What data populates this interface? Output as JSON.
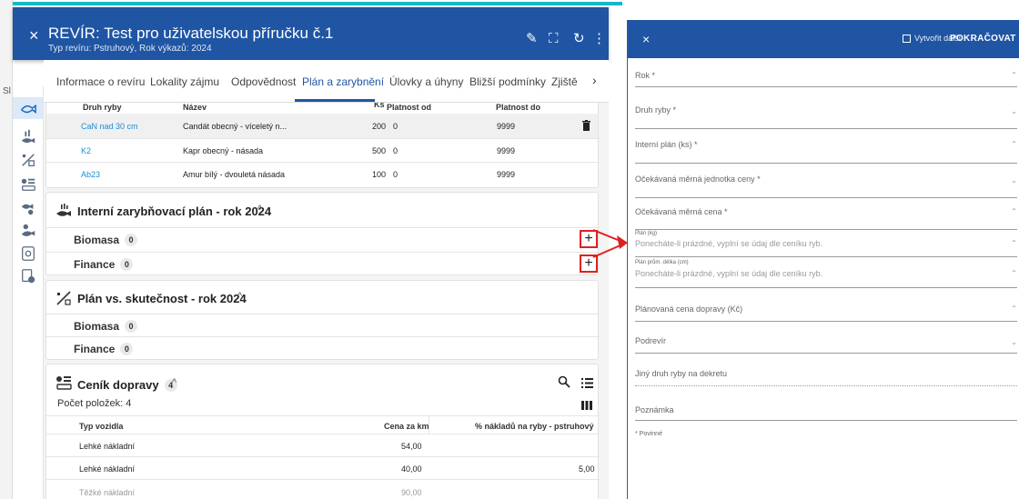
{
  "left": {
    "header": {
      "title": "REVÍR: Test pro uživatelskou příručku č.1",
      "subtitle": "Typ revíru: Pstruhový, Rok výkazů: 2024",
      "close_icon": "×",
      "edit_icon": "✎",
      "fullscreen_icon": "⛶",
      "refresh_icon": "↻",
      "more_icon": "⋮"
    },
    "tabs": [
      "Informace o revíru",
      "Lokality zájmu",
      "Odpovědnost",
      "Plán a zarybnění",
      "Úlovky a úhyny",
      "Bližší podmínky",
      "Zjiště"
    ],
    "tab_more": "›",
    "strip_label": "Sl",
    "fish_table": {
      "headers": [
        "Druh ryby",
        "Název",
        "Ks",
        "Platnost od",
        "Platnost do"
      ],
      "rows": [
        {
          "code": "CaN nad 30 cm",
          "name": "Candát obecný - víceletý n...",
          "ks": "200",
          "od": "0",
          "do": "9999"
        },
        {
          "code": "K2",
          "name": "Kapr obecný - násada",
          "ks": "500",
          "od": "0",
          "do": "9999"
        },
        {
          "code": "Ab23",
          "name": "Amur bílý - dvouletá násada",
          "ks": "100",
          "od": "0",
          "do": "9999"
        }
      ]
    },
    "internal_plan": {
      "title": "Interní zarybňovací plán - rok 2024",
      "caret": "^",
      "rows": [
        {
          "label": "Biomasa",
          "count": "0"
        },
        {
          "label": "Finance",
          "count": "0"
        }
      ]
    },
    "plan_vs_reality": {
      "title": "Plán vs. skutečnost - rok 2024",
      "caret": "^",
      "rows": [
        {
          "label": "Biomasa",
          "count": "0"
        },
        {
          "label": "Finance",
          "count": "0"
        }
      ]
    },
    "transport": {
      "title": "Ceník dopravy",
      "count": "4",
      "caret": "^",
      "item_count": "Počet položek: 4",
      "headers": [
        "Typ vozidla",
        "Cena za km",
        "% nákladů na ryby - pstruhový"
      ],
      "rows": [
        {
          "type": "Lehké nákladní",
          "price": "54,00",
          "pct": ""
        },
        {
          "type": "Lehké nákladní",
          "price": "40,00",
          "pct": "5,00"
        },
        {
          "type": "Těžké nákladní",
          "price": "90,00",
          "pct": ""
        }
      ]
    },
    "plus_label": "+",
    "annotation_color": "#e02020"
  },
  "right": {
    "close_icon": "×",
    "create_more_label": "Vytvořit další",
    "continue_label": "POKRAČOVAT",
    "fields": [
      {
        "label": "Rok *",
        "control": "⌃"
      },
      {
        "label": "Druh ryby *",
        "control": "⌄"
      },
      {
        "label": "Interní plán (ks) *",
        "control": "⌃"
      },
      {
        "label": "Očekávaná měrná jednotka ceny *",
        "control": "⌄"
      },
      {
        "label": "Očekávaná měrná cena *",
        "control": "⌃"
      },
      {
        "small": "Plán (kg)",
        "placeholder": "Ponecháte-li prázdné, vyplní se údaj dle ceníku ryb.",
        "control": "⌃"
      },
      {
        "small": "Plán prům. délka (cm)",
        "placeholder": "Ponecháte-li prázdné, vyplní se údaj dle ceníku ryb.",
        "control": "⌃"
      },
      {
        "label": "Plánovaná cena dopravy (Kč)",
        "control": "⌃"
      },
      {
        "label": "Podrevír",
        "control": "⌄"
      },
      {
        "label": "Jiný druh ryby na dekretu",
        "control": ""
      },
      {
        "label": "Poznámka",
        "control": ""
      }
    ],
    "required_note": "* Povinné"
  },
  "colors": {
    "primary": "#1f55a3",
    "link": "#1a8dd8",
    "accent_line": "#14b8c8",
    "annotation": "#e02020"
  }
}
